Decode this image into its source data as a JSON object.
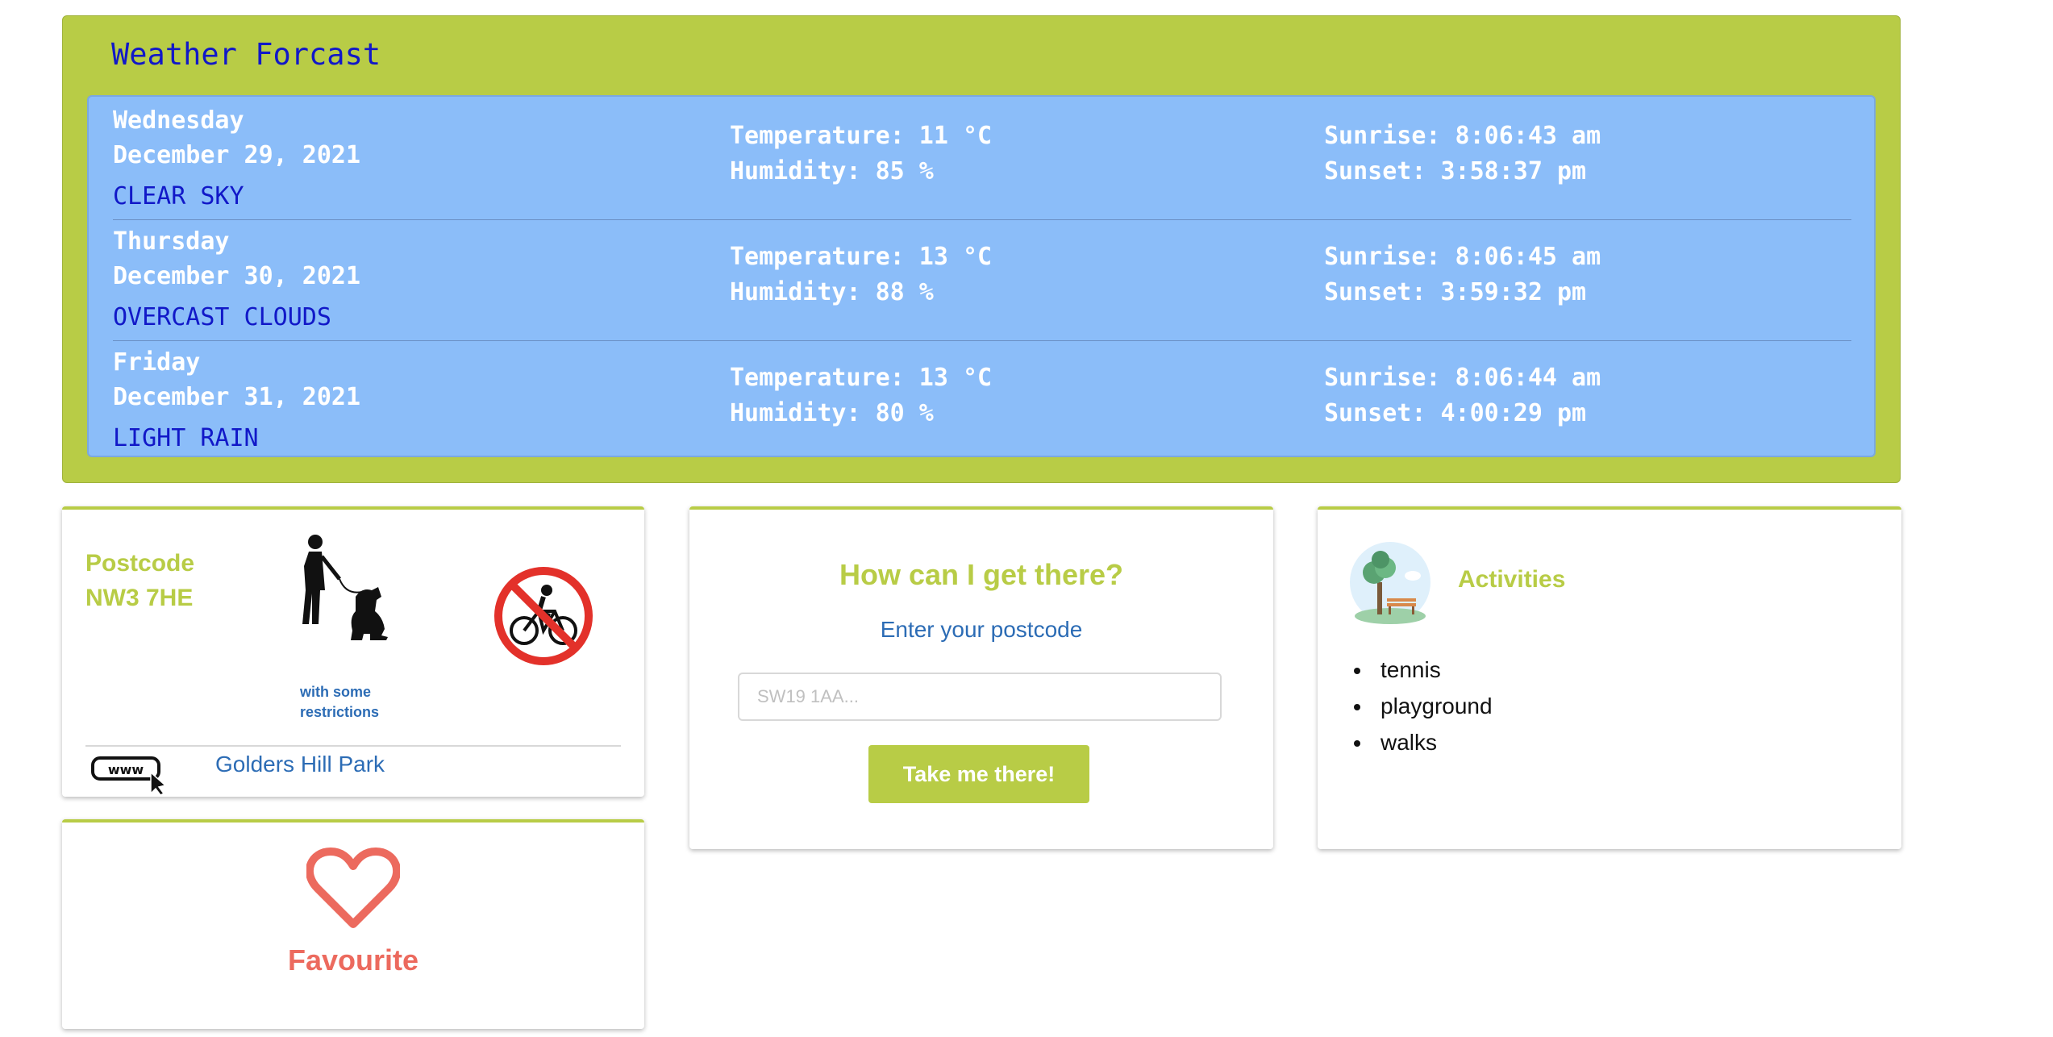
{
  "weather": {
    "title": "Weather Forcast",
    "days": [
      {
        "day": "Wednesday",
        "date": "December 29, 2021",
        "condition": "CLEAR SKY",
        "temperature": "Temperature: 11 °C",
        "humidity": "Humidity: 85 %",
        "sunrise": "Sunrise: 8:06:43 am",
        "sunset": "Sunset: 3:58:37 pm"
      },
      {
        "day": "Thursday",
        "date": "December 30, 2021",
        "condition": "OVERCAST CLOUDS",
        "temperature": "Temperature: 13 °C",
        "humidity": "Humidity: 88 %",
        "sunrise": "Sunrise: 8:06:45 am",
        "sunset": "Sunset: 3:59:32 pm"
      },
      {
        "day": "Friday",
        "date": "December 31, 2021",
        "condition": "LIGHT RAIN",
        "temperature": "Temperature: 13 °C",
        "humidity": "Humidity: 80 %",
        "sunrise": "Sunrise: 8:06:44 am",
        "sunset": "Sunset: 4:00:29 pm"
      }
    ]
  },
  "park": {
    "postcode_label": "Postcode",
    "postcode": "NW3 7HE",
    "dog_note": "with some restrictions",
    "link_text": "Golders Hill Park",
    "www_icon_text": "www"
  },
  "favourite": {
    "label": "Favourite"
  },
  "route": {
    "title": "How can I get there?",
    "subtitle": "Enter your postcode",
    "input_value": "",
    "input_placeholder": "SW19 1AA...",
    "button_label": "Take me there!"
  },
  "activities": {
    "title": "Activities",
    "items": [
      "tennis",
      "playground",
      "walks"
    ]
  },
  "colors": {
    "accent_green": "#b8cc46",
    "panel_blue": "#8bbdf9",
    "condition_blue": "#1118c8",
    "link_blue": "#2c6cb5",
    "favourite_red": "#ec6a5e"
  }
}
